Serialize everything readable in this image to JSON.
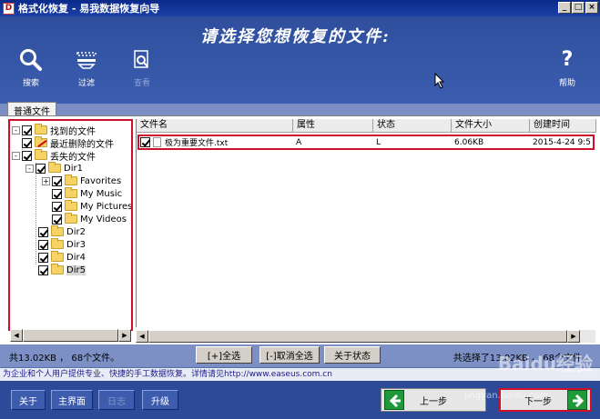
{
  "window": {
    "title": "格式化恢复 - 易我数据恢复向导",
    "app_icon_letter": "D",
    "controls": [
      "minimize-icon",
      "maximize-icon",
      "close-icon"
    ]
  },
  "banner": {
    "title": "请选择您想恢复的文件:"
  },
  "toolbar": {
    "search_label": "搜索",
    "filter_label": "过滤",
    "view_label": "查看",
    "help_label": "帮助",
    "help_glyph": "?"
  },
  "tabs": [
    {
      "label": "普通文件"
    }
  ],
  "tree": {
    "items": [
      {
        "label": "找到的文件",
        "checked": true,
        "icon": "folder-icon"
      },
      {
        "label": "最近删除的文件",
        "checked": true,
        "icon": "deleted-folder-icon"
      },
      {
        "label": "丢失的文件",
        "checked": true,
        "icon": "folder-icon"
      },
      {
        "label": "Dir1",
        "checked": true,
        "icon": "folder-icon"
      },
      {
        "label": "Favorites",
        "checked": true,
        "icon": "folder-icon",
        "expander": "+"
      },
      {
        "label": "My Music",
        "checked": true,
        "icon": "folder-icon"
      },
      {
        "label": "My Pictures",
        "checked": true,
        "icon": "folder-icon"
      },
      {
        "label": "My Videos",
        "checked": true,
        "icon": "folder-icon"
      },
      {
        "label": "Dir2",
        "checked": true,
        "icon": "folder-icon"
      },
      {
        "label": "Dir3",
        "checked": true,
        "icon": "folder-icon"
      },
      {
        "label": "Dir4",
        "checked": true,
        "icon": "folder-icon"
      },
      {
        "label": "Dir5",
        "checked": true,
        "icon": "folder-icon",
        "selected": true
      }
    ],
    "tree_expander_minus": "-"
  },
  "file_list": {
    "columns": [
      "文件名",
      "属性",
      "状态",
      "文件大小",
      "创建时间"
    ],
    "rows": [
      {
        "name": "极为重要文件.txt",
        "attr": "A",
        "status": "L",
        "size": "6.06KB",
        "created": "2015-4-24 9:5",
        "checked": true
      }
    ]
  },
  "status": {
    "left": "共13.02KB ， 68个文件。",
    "right": "共选择了13.02KB ， 68个文件。",
    "select_all": "[+]全选",
    "deselect_all": "[-]取消全选",
    "about_status": "关于状态"
  },
  "info_text": "为企业和个人用户提供专业、快捷的手工数据恢复。详情请见http://www.easeus.com.cn",
  "footer": {
    "about": "关于",
    "main_ui": "主界面",
    "log": "日志",
    "upgrade": "升级",
    "prev": "上一步",
    "next": "下一步"
  },
  "watermark": {
    "logo": "Baidu经验",
    "url": "jingyan.baidu.com"
  },
  "colors": {
    "highlight_border": "#d0102a",
    "banner_bg": "#2f4f9d",
    "footer_bg": "#2c4a98",
    "arrow_green": "#1f9a3b"
  }
}
